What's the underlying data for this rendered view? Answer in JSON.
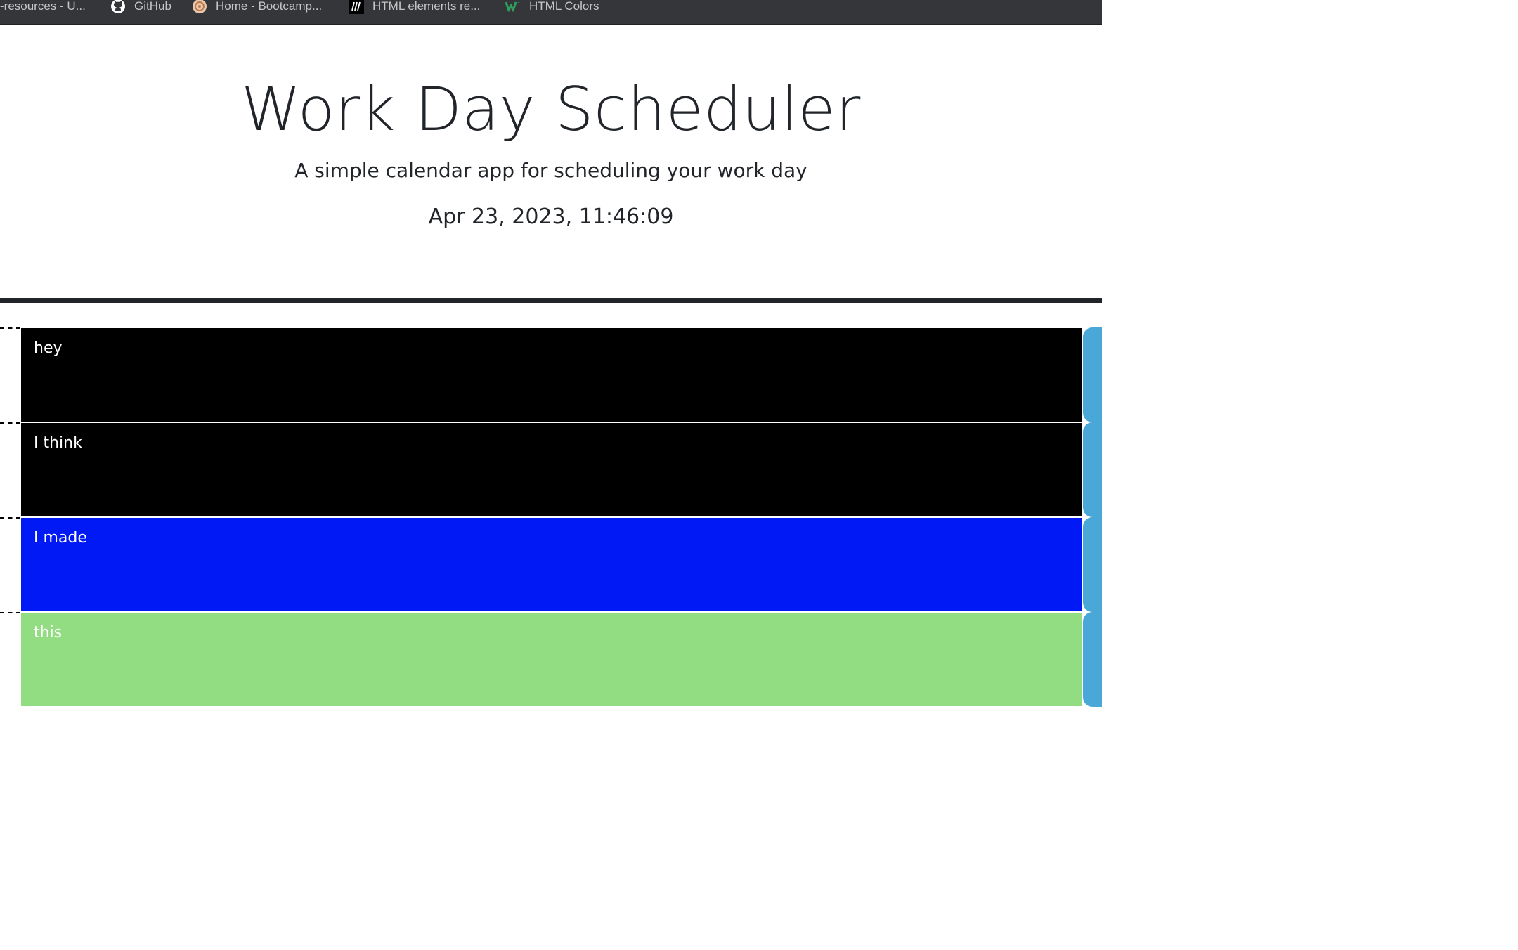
{
  "bookmarks": [
    {
      "label": "-resources - U...",
      "icon": "none"
    },
    {
      "label": "GitHub",
      "icon": "github-icon"
    },
    {
      "label": "Home - Bootcamp...",
      "icon": "bootcamp-icon"
    },
    {
      "label": "HTML elements re...",
      "icon": "mdn-icon"
    },
    {
      "label": "HTML Colors",
      "icon": "w3schools-icon"
    }
  ],
  "header": {
    "title": "Work Day Scheduler",
    "subtitle": "A simple calendar app for scheduling your work day",
    "current_day": "Apr 23, 2023, 11:46:09"
  },
  "time_blocks": [
    {
      "description": "hey",
      "bg_color": "#000000"
    },
    {
      "description": "I think",
      "bg_color": "#000000"
    },
    {
      "description": "I made",
      "bg_color": "#0019f5"
    },
    {
      "description": "this",
      "bg_color": "#92dc82"
    }
  ],
  "colors": {
    "bookmark_bar": "#35363a",
    "save_button": "#4aa8d8",
    "text_dark": "#212529"
  }
}
